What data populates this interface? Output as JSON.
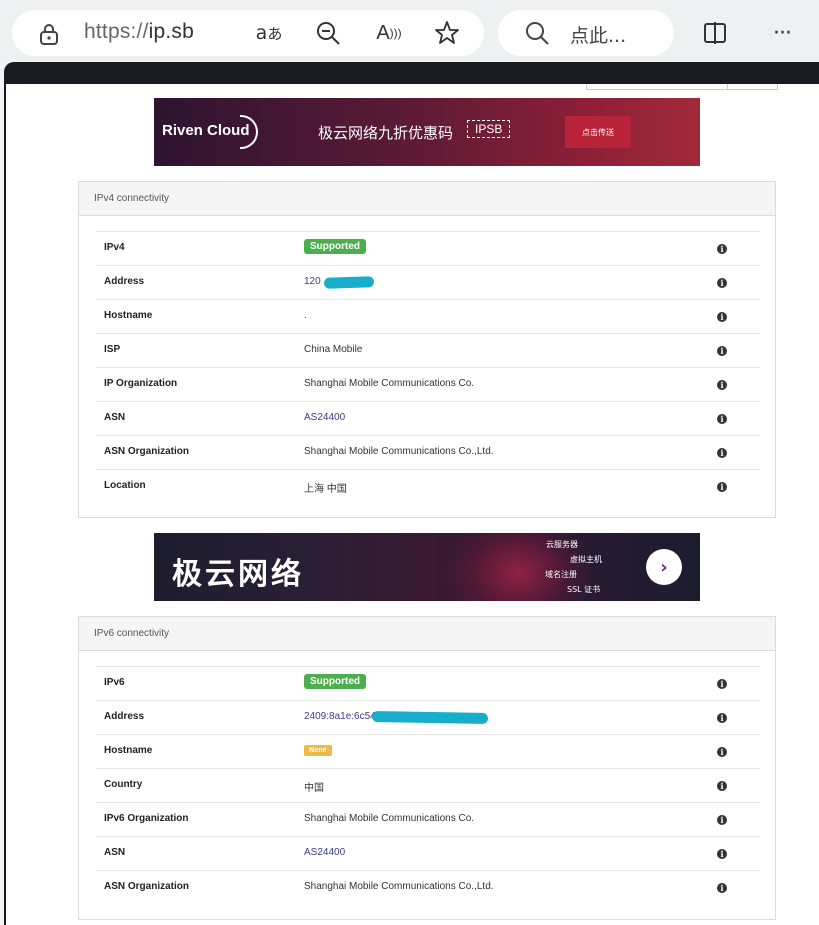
{
  "browser": {
    "url_scheme": "https://",
    "url_host": "ip.sb",
    "search_placeholder": "点此...",
    "icons": [
      "lock-icon",
      "translate-icon",
      "zoom-out-icon",
      "read-aloud-icon",
      "favorite-star-icon",
      "search-icon",
      "split-screen-icon",
      "more-icon"
    ]
  },
  "banner_top": {
    "brand": "Riven Cloud",
    "text": "极云网络九折优惠码",
    "code": "IPSB",
    "button": "点击传送"
  },
  "banner_mid": {
    "title": "极云网络",
    "tags": [
      "云服务器",
      "虚拟主机",
      "域名注册",
      "SSL 证书"
    ]
  },
  "ipv4": {
    "title": "IPv4 connectivity",
    "rows": [
      {
        "label": "IPv4",
        "badge": "Supported"
      },
      {
        "label": "Address",
        "value": "120"
      },
      {
        "label": "Hostname",
        "value": "."
      },
      {
        "label": "ISP",
        "value": "China Mobile"
      },
      {
        "label": "IP Organization",
        "value": "Shanghai Mobile Communications Co."
      },
      {
        "label": "ASN",
        "value": "AS24400"
      },
      {
        "label": "ASN Organization",
        "value": "Shanghai Mobile Communications Co.,Ltd."
      },
      {
        "label": "Location",
        "value": "上海 中国"
      }
    ]
  },
  "ipv6": {
    "title": "IPv6 connectivity",
    "rows": [
      {
        "label": "IPv6",
        "badge": "Supported"
      },
      {
        "label": "Address",
        "value": "2409:8a1e:6c54"
      },
      {
        "label": "Hostname",
        "badge": "None"
      },
      {
        "label": "Country",
        "value": "中国"
      },
      {
        "label": "IPv6 Organization",
        "value": "Shanghai Mobile Communications Co."
      },
      {
        "label": "ASN",
        "value": "AS24400"
      },
      {
        "label": "ASN Organization",
        "value": "Shanghai Mobile Communications Co.,Ltd."
      }
    ]
  },
  "colors": {
    "supported": "#4cae4c",
    "none": "#efb94a",
    "link": "#3a3a8e",
    "redaction": "#16aecb"
  }
}
